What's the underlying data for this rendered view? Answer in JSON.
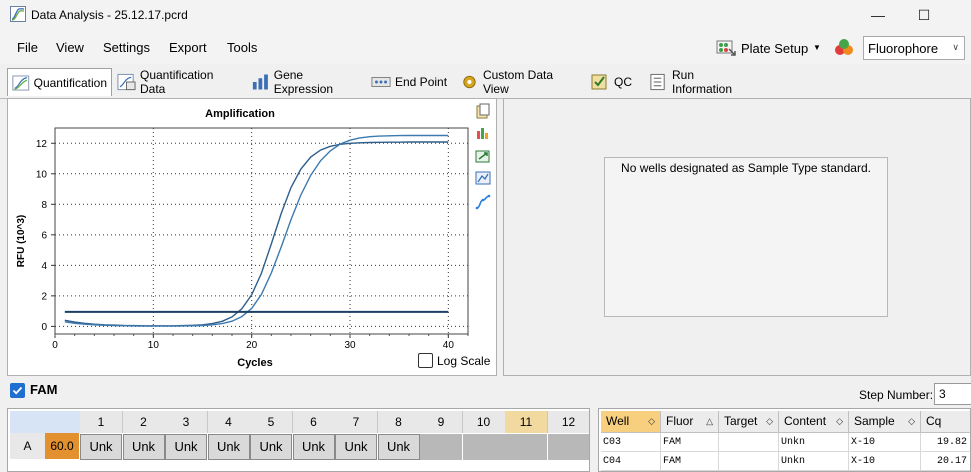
{
  "window": {
    "title": "Data Analysis - 25.12.17.pcrd"
  },
  "menu": [
    "File",
    "View",
    "Settings",
    "Export",
    "Tools"
  ],
  "toolbar": {
    "plate_setup": "Plate Setup",
    "fluorophore": "Fluorophore"
  },
  "tabs": [
    {
      "label": "Quantification",
      "icon": "amplification-icon",
      "active": true
    },
    {
      "label": "Quantification Data",
      "icon": "quant-data-icon"
    },
    {
      "label": "Gene Expression",
      "icon": "bar-chart-icon"
    },
    {
      "label": "End Point",
      "icon": "end-point-icon"
    },
    {
      "label": "Custom Data View",
      "icon": "gear-icon"
    },
    {
      "label": "QC",
      "icon": "qc-check-icon"
    },
    {
      "label": "Run Information",
      "icon": "run-info-icon"
    }
  ],
  "chart_data": {
    "type": "line",
    "title": "Amplification",
    "xlabel": "Cycles",
    "ylabel": "RFU (10^3)",
    "xlim": [
      0,
      42
    ],
    "ylim": [
      -0.5,
      13
    ],
    "xticks": [
      0,
      10,
      20,
      30,
      40
    ],
    "yticks": [
      0,
      2,
      4,
      6,
      8,
      10,
      12
    ],
    "grid": true,
    "series": [
      {
        "color": "#2e5e8c",
        "x": [
          1,
          2,
          3,
          4,
          5,
          6,
          7,
          8,
          9,
          10,
          11,
          12,
          13,
          14,
          15,
          16,
          17,
          18,
          19,
          20,
          21,
          22,
          23,
          24,
          25,
          26,
          27,
          28,
          29,
          30,
          31,
          32,
          33,
          34,
          35,
          36,
          37,
          38,
          39,
          40
        ],
        "values": [
          0.4,
          0.28,
          0.2,
          0.14,
          0.1,
          0.08,
          0.06,
          0.05,
          0.04,
          0.04,
          0.04,
          0.04,
          0.05,
          0.07,
          0.1,
          0.18,
          0.33,
          0.62,
          1.15,
          2.07,
          3.5,
          5.4,
          7.4,
          9.1,
          10.3,
          11.1,
          11.55,
          11.8,
          11.93,
          12.0,
          12.03,
          12.05,
          12.06,
          12.07,
          12.07,
          12.08,
          12.08,
          12.08,
          12.08,
          12.08
        ]
      },
      {
        "color": "#3d7ab0",
        "x": [
          1,
          2,
          3,
          4,
          5,
          6,
          7,
          8,
          9,
          10,
          11,
          12,
          13,
          14,
          15,
          16,
          17,
          18,
          19,
          20,
          21,
          22,
          23,
          24,
          25,
          26,
          27,
          28,
          29,
          30,
          31,
          32,
          33,
          34,
          35,
          36,
          37,
          38,
          39,
          40
        ],
        "values": [
          0.3,
          0.2,
          0.14,
          0.1,
          0.07,
          0.05,
          0.04,
          0.03,
          0.02,
          0.02,
          0.02,
          0.02,
          0.03,
          0.04,
          0.06,
          0.1,
          0.18,
          0.34,
          0.64,
          1.18,
          2.1,
          3.5,
          5.2,
          7.0,
          8.6,
          9.9,
          10.85,
          11.5,
          11.95,
          12.2,
          12.35,
          12.43,
          12.47,
          12.49,
          12.5,
          12.51,
          12.51,
          12.51,
          12.51,
          12.51
        ]
      }
    ],
    "threshold": {
      "value": 0.95,
      "color": "#1b3f66"
    },
    "log_scale": {
      "label": "Log Scale",
      "checked": false
    }
  },
  "right_panel": {
    "message": "No wells designated as Sample Type standard."
  },
  "fam": {
    "label": "FAM",
    "checked": true,
    "step_label": "Step Number:",
    "step_value": "3"
  },
  "plate": {
    "columns": [
      "1",
      "2",
      "3",
      "4",
      "5",
      "6",
      "7",
      "8",
      "9",
      "10",
      "11",
      "12"
    ],
    "selected_column": "11",
    "rows": [
      {
        "label": "A",
        "value": "60.0",
        "cells": [
          "Unk",
          "Unk",
          "Unk",
          "Unk",
          "Unk",
          "Unk",
          "Unk",
          "Unk",
          "",
          "",
          "",
          ""
        ]
      }
    ]
  },
  "results": {
    "headers": [
      "Well",
      "Fluor",
      "Target",
      "Content",
      "Sample",
      "Cq"
    ],
    "rows": [
      [
        "C03",
        "FAM",
        "",
        "Unkn",
        "X-10",
        "19.82"
      ],
      [
        "C04",
        "FAM",
        "",
        "Unkn",
        "X-10",
        "20.17"
      ]
    ]
  }
}
